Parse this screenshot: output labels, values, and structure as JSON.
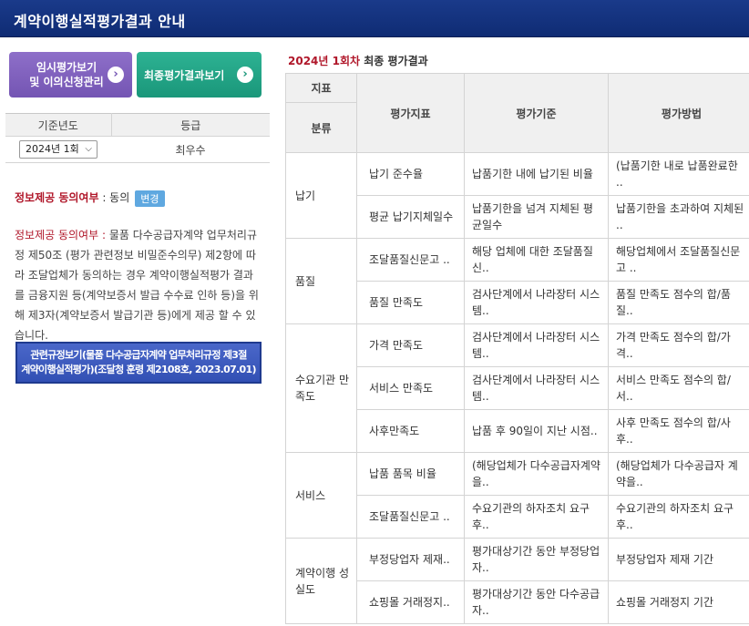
{
  "page": {
    "title": "계약이행실적평가결과 안내"
  },
  "buttons": {
    "temp_eval_line1": "임시평가보기",
    "temp_eval_line2": "및 이의신청관리",
    "final_eval": "최종평가결과보기",
    "arrow": "›"
  },
  "year_table": {
    "headers": [
      "기준년도",
      "등급"
    ],
    "selected_period": "2024년 1회",
    "grade": "최우수"
  },
  "consent": {
    "label": "정보제공 동의여부",
    "separator": " : ",
    "value": "동의",
    "change_button": "변경"
  },
  "info": {
    "label": "정보제공 동의여부 :",
    "text": " 물품 다수공급자계약 업무처리규정 제50조 (평가 관련정보 비밀준수의무) 제2항에 따라 조달업체가 동의하는 경우 계약이행실적평가 결과를 금융지원 등(계약보증서 발급 수수료 인하 등)을 위해 제3자(계약보증서 발급기관 등)에게 제공 할 수 있습니다."
  },
  "law_button": {
    "line1": "관련규정보기(물품 다수공급자계약 업무처리규정 제3절",
    "line2": "계약이행실적평가)(조달청 훈령 제2108호, 2023.07.01)"
  },
  "result": {
    "heading_year": "2024년 1회차",
    "heading_rest": " 최종 평가결과",
    "headers": {
      "indicator_top": "지표",
      "category": "분류",
      "indicator": "평가지표",
      "criteria": "평가기준",
      "method": "평가방법"
    },
    "rows": [
      {
        "category": "납기",
        "indicator": "납기 준수율",
        "criteria": "납품기한 내에 납기된 비율",
        "method": "(납품기한 내로 납품완료한 .."
      },
      {
        "indicator": "평균 납기지체일수",
        "criteria": "납품기한을 넘겨 지체된 평균일수",
        "method": "납품기한을 초과하여 지체된 .."
      },
      {
        "category": "품질",
        "indicator": "조달품질신문고 ..",
        "criteria": "해당 업체에 대한 조달품질신..",
        "method": "해당업체에서 조달품질신문고 .."
      },
      {
        "indicator": "품질 만족도",
        "criteria": "검사단계에서 나라장터 시스템..",
        "method": "품질 만족도 점수의 합/품질.."
      },
      {
        "category": "수요기관 만족도",
        "indicator": "가격 만족도",
        "criteria": "검사단계에서 나라장터 시스템..",
        "method": "가격 만족도 점수의 합/가격.."
      },
      {
        "indicator": "서비스 만족도",
        "criteria": "검사단계에서 나라장터 시스템..",
        "method": "서비스 만족도 점수의 합/서.."
      },
      {
        "indicator": "사후만족도",
        "criteria": "납품 후 90일이 지난 시점..",
        "method": "사후 만족도 점수의 합/사후.."
      },
      {
        "category": "서비스",
        "indicator": "납품 품목 비율",
        "criteria": "(해당업체가 다수공급자계약을..",
        "method": "(해당업체가 다수공급자 계약을.."
      },
      {
        "indicator": "조달품질신문고 ..",
        "criteria": "수요기관의 하자조치 요구 후..",
        "method": "수요기관의 하자조치 요구 후.."
      },
      {
        "category": "계약이행 성실도",
        "indicator": "부정당업자 제재..",
        "criteria": "평가대상기간 동안 부정당업자..",
        "method": "부정당업자 제재 기간"
      },
      {
        "indicator": "쇼핑몰 거래정지..",
        "criteria": "평가대상기간 동안 다수공급자..",
        "method": "쇼핑몰 거래정지 기간"
      }
    ]
  }
}
